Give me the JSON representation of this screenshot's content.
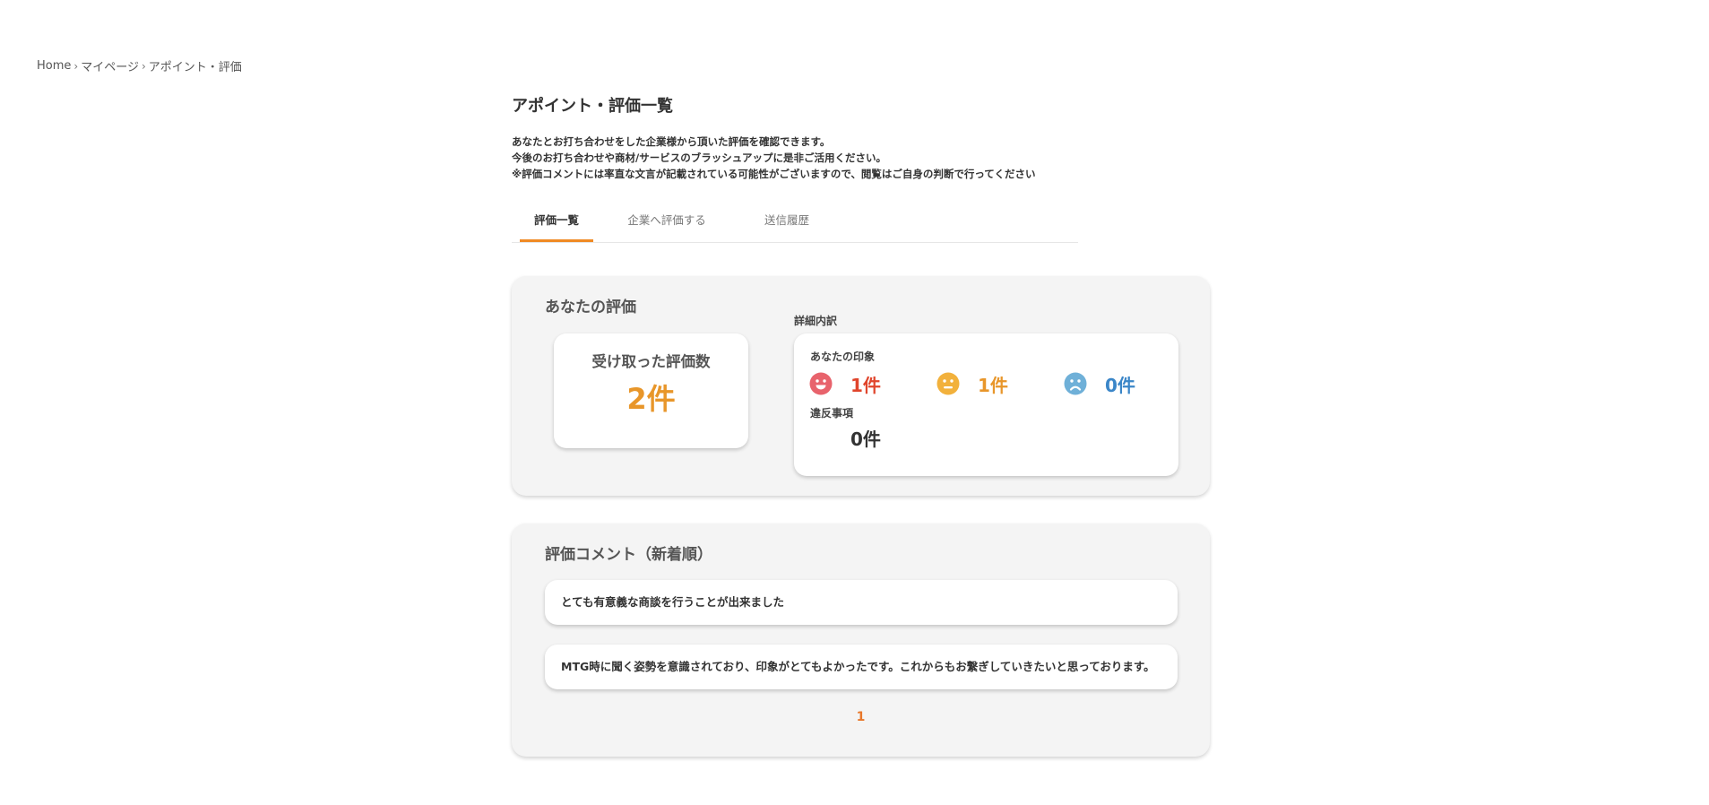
{
  "breadcrumb": {
    "items": [
      "Home",
      "マイページ",
      "アポイント・評価"
    ],
    "separator": "›"
  },
  "page": {
    "title": "アポイント・評価一覧",
    "description": [
      "あなたとお打ち合わせをした企業様から頂いた評価を確認できます。",
      "今後のお打ち合わせや商材/サービスのブラッシュアップに是非ご活用ください。",
      "※評価コメントには率直な文言が記載されている可能性がございますので、閲覧はご自身の判断で行ってください"
    ]
  },
  "tabs": [
    {
      "label": "評価一覧",
      "active": true
    },
    {
      "label": "企業へ評価する",
      "active": false
    },
    {
      "label": "送信履歴",
      "active": false
    }
  ],
  "evaluation": {
    "title": "あなたの評価",
    "received_label": "受け取った評価数",
    "received_count": "2件",
    "detail_label": "詳細内訳",
    "impression_label": "あなたの印象",
    "impressions": [
      {
        "icon": "happy-face-icon",
        "count": "1件",
        "color": "#e0452c"
      },
      {
        "icon": "neutral-face-icon",
        "count": "1件",
        "color": "#e8962a"
      },
      {
        "icon": "sad-face-icon",
        "count": "0件",
        "color": "#3b86c8"
      }
    ],
    "violation_label": "違反事項",
    "violation_count": "0件"
  },
  "comments": {
    "title": "評価コメント（新着順）",
    "items": [
      "とても有意義な商談を行うことが出来ました",
      "MTG時に聞く姿勢を意識されており、印象がとてもよかったです。これからもお繋ぎしていきたいと思っております。"
    ]
  },
  "pagination": {
    "current": "1"
  },
  "colors": {
    "accent": "#f08a24",
    "card_bg": "#f4f4f4"
  }
}
